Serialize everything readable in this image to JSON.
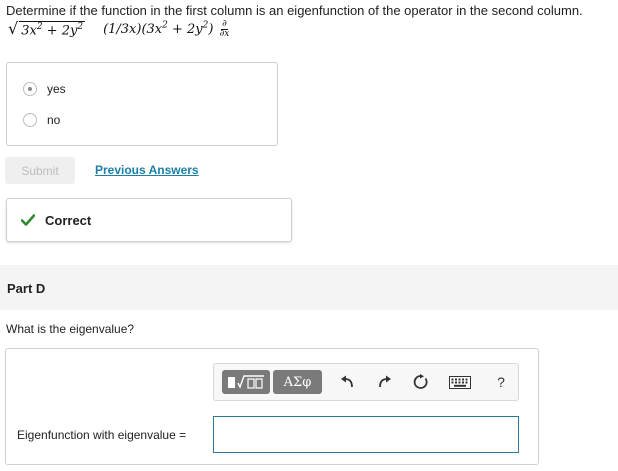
{
  "prompt": "Determine if the function in the first column is an eigenfunction of the operator in the second column.",
  "math": {
    "function": {
      "radicand_a": "3x",
      "exp_a": "2",
      "plus": " + 2y",
      "exp_b": "2"
    },
    "operator": {
      "prefix": "(1/3x)(3x",
      "exp_a": "2",
      "mid": " + 2y",
      "exp_b": "2",
      "suffix": ")",
      "d_num": "∂",
      "d_den": "∂x"
    }
  },
  "choices": [
    {
      "label": "yes",
      "selected": true
    },
    {
      "label": "no",
      "selected": false
    }
  ],
  "buttons": {
    "submit": "Submit",
    "previous_answers": "Previous Answers"
  },
  "feedback": {
    "text": "Correct",
    "color": "#2e8a2e"
  },
  "part": {
    "label": "Part D",
    "question": "What is the eigenvalue?"
  },
  "toolbar": {
    "templates_icon": "templates-icon",
    "greek": "ΑΣφ",
    "undo_icon": "undo-icon",
    "redo_icon": "redo-icon",
    "reset_icon": "reset-icon",
    "keyboard_icon": "keyboard-icon",
    "help": "?"
  },
  "answer": {
    "label": "Eigenfunction with eigenvalue =",
    "value": ""
  }
}
